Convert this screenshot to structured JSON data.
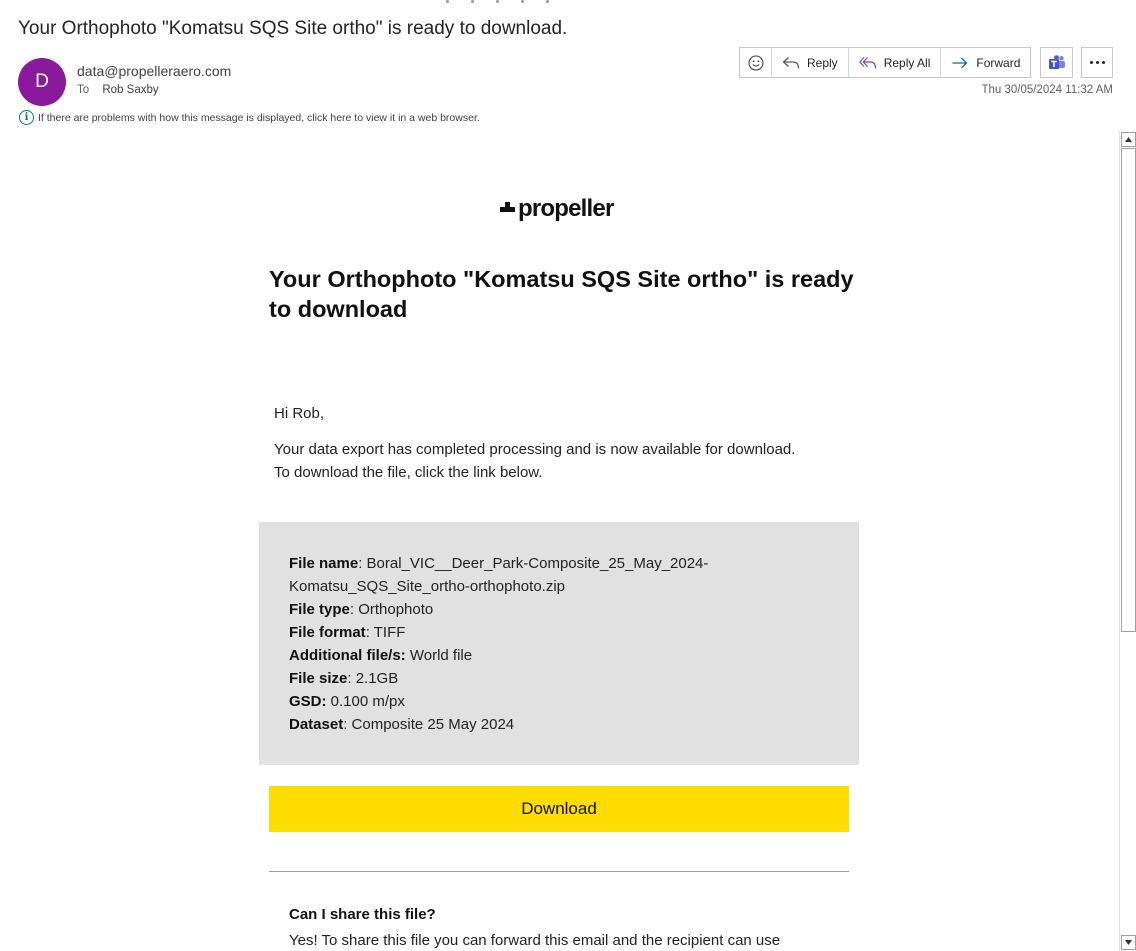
{
  "message": {
    "subject": "Your Orthophoto \"Komatsu SQS Site ortho\" is ready to download.",
    "avatar_initial": "D",
    "avatar_color": "#8a1a9b",
    "sender": "data@propelleraero.com",
    "to_label": "To",
    "recipient": "Rob Saxby",
    "info_notice": "If there are problems with how this message is displayed, click here to view it in a web browser.",
    "timestamp": "Thu 30/05/2024 11:32 AM"
  },
  "toolbar": {
    "emoji_icon": "smiley-icon",
    "reply_label": "Reply",
    "reply_all_label": "Reply All",
    "forward_label": "Forward",
    "teams_icon": "teams-icon",
    "more_icon": "more-icon"
  },
  "email": {
    "logo_text": "propeller",
    "headline": "Your Orthophoto \"Komatsu SQS Site ortho\" is ready to download",
    "greeting": "Hi Rob,",
    "intro_line1": "Your data export has completed processing and is now available for download.",
    "intro_line2": "To download the file, click the link below.",
    "details": {
      "file_name_label": "File name",
      "file_name_value_1": "Boral_VIC__Deer_Park-Composite_25_May_2024-",
      "file_name_value_2": "Komatsu_SQS_Site_ortho-orthophoto.zip",
      "file_type_label": "File type",
      "file_type_value": "Orthophoto",
      "file_format_label": "File format",
      "file_format_value": "TIFF",
      "additional_label": "Additional file/s:",
      "additional_value": "World file",
      "file_size_label": "File size",
      "file_size_value": "2.1GB",
      "gsd_label": "GSD:",
      "gsd_value": "0.100 m/px",
      "dataset_label": "Dataset",
      "dataset_value": "Composite 25 May 2024"
    },
    "download_label": "Download",
    "download_color": "#ffdc00",
    "faq_question": "Can I share this file?",
    "faq_answer": "Yes! To share this file you can forward this email and the recipient can use"
  }
}
